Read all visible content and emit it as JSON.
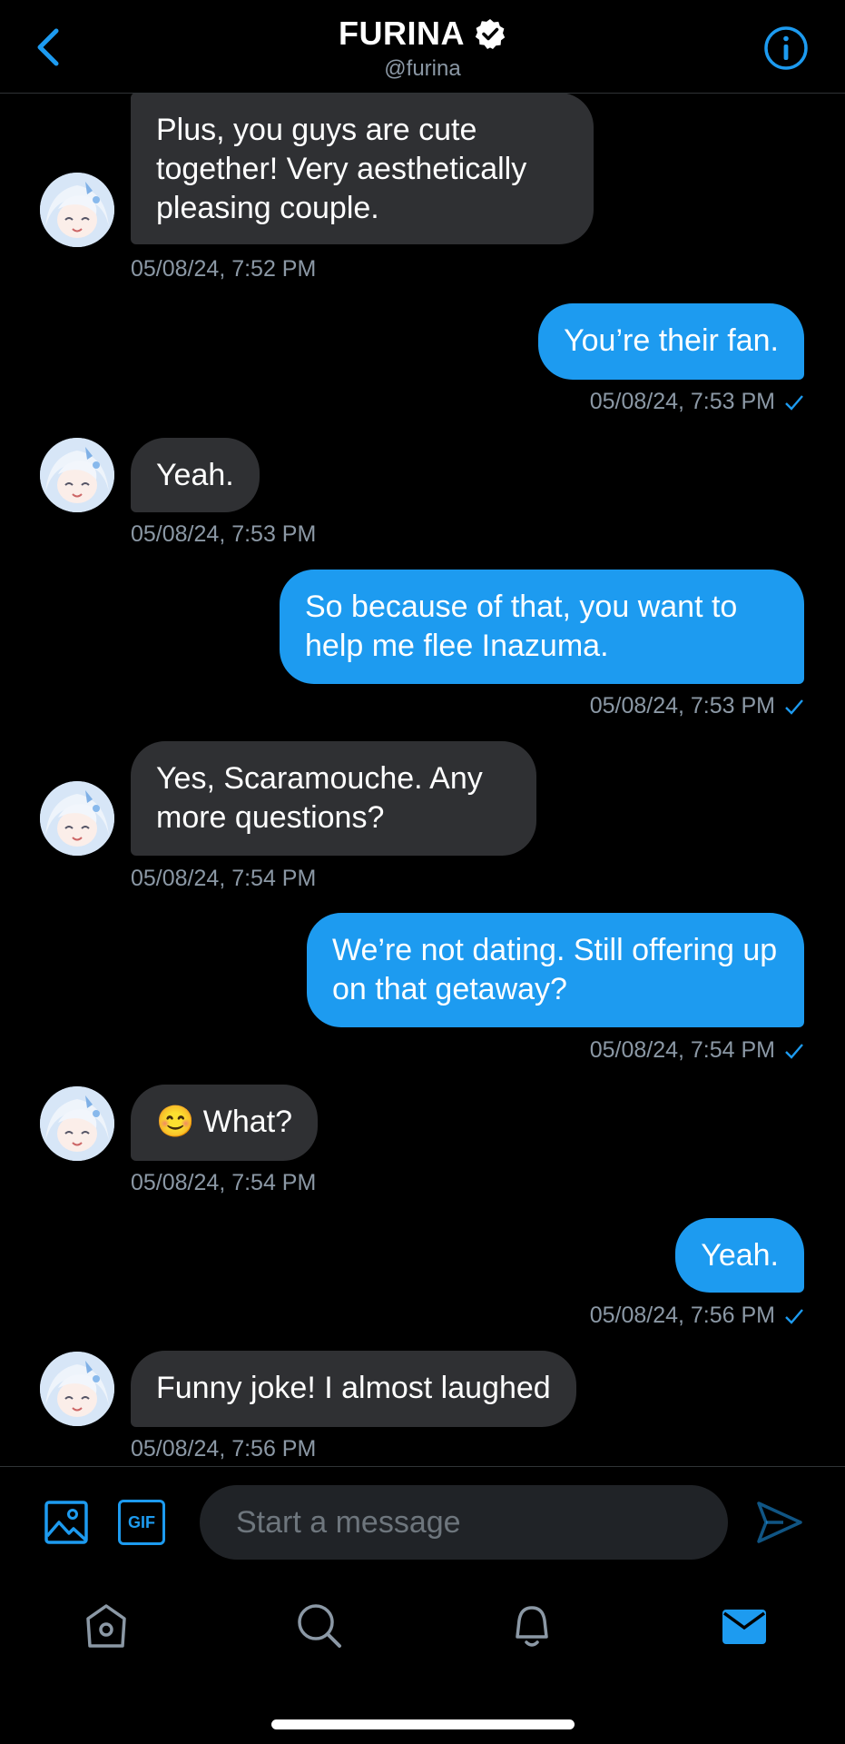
{
  "header": {
    "name": "FURINA",
    "handle": "@furina",
    "back_icon": "chevron-left-icon",
    "info_icon": "info-icon",
    "verified_icon": "verified-badge-icon"
  },
  "messages": [
    {
      "side": "in",
      "text": "Plus, you guys are cute together! Very aesthetically pleasing couple.",
      "time": "05/08/24, 7:52 PM"
    },
    {
      "side": "out",
      "text": "You’re their fan.",
      "time": "05/08/24, 7:53 PM"
    },
    {
      "side": "in",
      "text": "Yeah.",
      "time": "05/08/24, 7:53 PM"
    },
    {
      "side": "out",
      "text": "So because of that, you want to help me flee Inazuma.",
      "time": "05/08/24, 7:53 PM"
    },
    {
      "side": "in",
      "text": "Yes, Scaramouche. Any more questions?",
      "time": "05/08/24, 7:54 PM"
    },
    {
      "side": "out",
      "text": "We’re not dating. Still offering up on that getaway?",
      "time": "05/08/24, 7:54 PM"
    },
    {
      "side": "in",
      "text": "😊 What?",
      "time": "05/08/24, 7:54 PM"
    },
    {
      "side": "out",
      "text": "Yeah.",
      "time": "05/08/24, 7:56 PM"
    },
    {
      "side": "in",
      "text": "Funny joke! I almost laughed",
      "time": "05/08/24, 7:56 PM"
    }
  ],
  "composer": {
    "placeholder": "Start a message",
    "gif_label": "GIF",
    "image_icon": "image-icon",
    "send_icon": "send-icon"
  },
  "tabbar": {
    "items": [
      "home-icon",
      "search-icon",
      "notifications-icon",
      "messages-icon"
    ],
    "active": "messages-icon"
  },
  "colors": {
    "accent": "#1d9bf0",
    "incoming_bubble": "#2f3033",
    "background": "#000000",
    "timestamp": "#8b98a5"
  }
}
